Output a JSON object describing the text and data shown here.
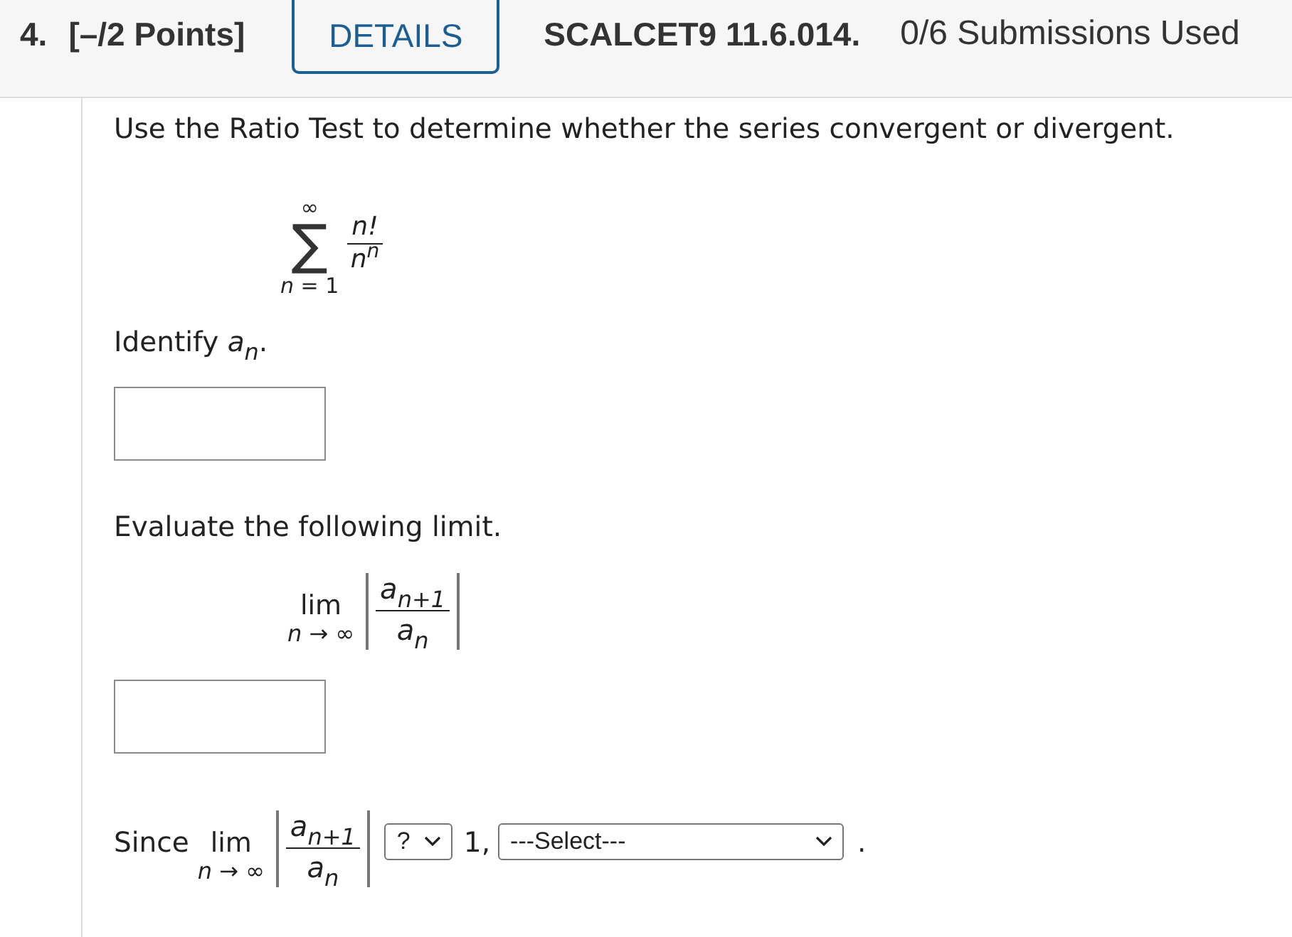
{
  "header": {
    "number": "4.",
    "points": "[–/2 Points]",
    "details_button": "DETAILS",
    "problem_code": "SCALCET9 11.6.014.",
    "submissions": "0/6 Submissions Used"
  },
  "question": {
    "prompt": "Use the Ratio Test to determine whether the series convergent or divergent.",
    "series": {
      "upper_limit": "∞",
      "operator": "∑",
      "lower_limit": "*n* = 1",
      "numerator": "n!",
      "denominator": "n$^{n}$"
    },
    "identify_prompt": "Identify *a*$_{n}$.",
    "limit_prompt": "Evaluate the following limit.",
    "limit": {
      "operator": "lim",
      "subscript": "*n* → ∞",
      "numerator": "*a*$_{n+1}$",
      "denominator": "*a*$_{n}$"
    },
    "conclusion": {
      "lead": "Since",
      "limit": {
        "operator": "lim",
        "subscript": "*n* → ∞",
        "numerator": "*a*$_{n+1}$",
        "denominator": "*a*$_{n}$"
      },
      "comparison_select": "?",
      "middle": "1,",
      "conclusion_select": "---Select---",
      "end": "."
    }
  }
}
